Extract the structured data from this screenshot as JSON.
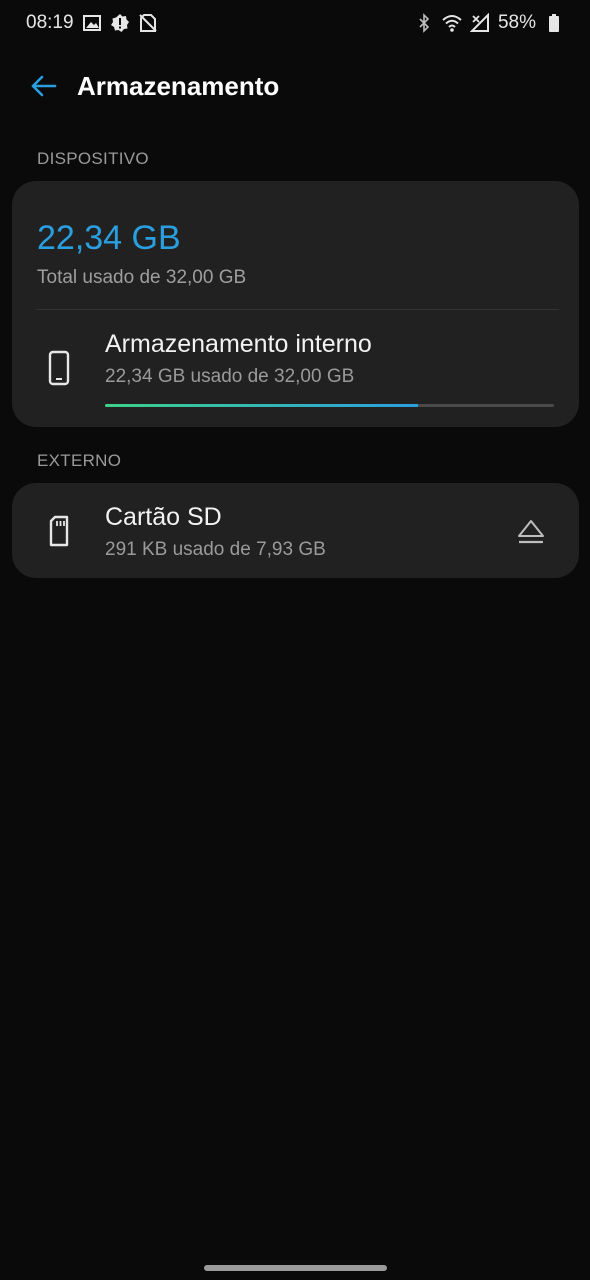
{
  "status_bar": {
    "time": "08:19",
    "battery": "58%",
    "left_icons": [
      "image-icon",
      "settings-badge-icon",
      "no-sim-icon"
    ],
    "right_icons": [
      "bluetooth-icon",
      "wifi-icon",
      "signal-icon",
      "battery-icon"
    ]
  },
  "app_bar": {
    "back_icon": "arrow-left-icon",
    "title": "Armazenamento"
  },
  "device_section": {
    "header": "DISPOSITIVO",
    "total_used": "22,34 GB",
    "total_sub": "Total usado de 32,00 GB",
    "internal": {
      "icon": "phone-icon",
      "title": "Armazenamento interno",
      "subtitle": "22,34 GB usado de 32,00 GB",
      "progress_fraction": 0.698
    }
  },
  "external_section": {
    "header": "EXTERNO",
    "sd_card": {
      "icon": "sd-card-icon",
      "title": "Cartão SD",
      "subtitle": "291 KB usado de 7,93 GB",
      "action_icon": "eject-icon"
    }
  },
  "colors": {
    "accent": "#2a9fe0",
    "progress_start": "#3ed18a",
    "card_background": "#212121",
    "page_background": "#0a0a0a"
  }
}
